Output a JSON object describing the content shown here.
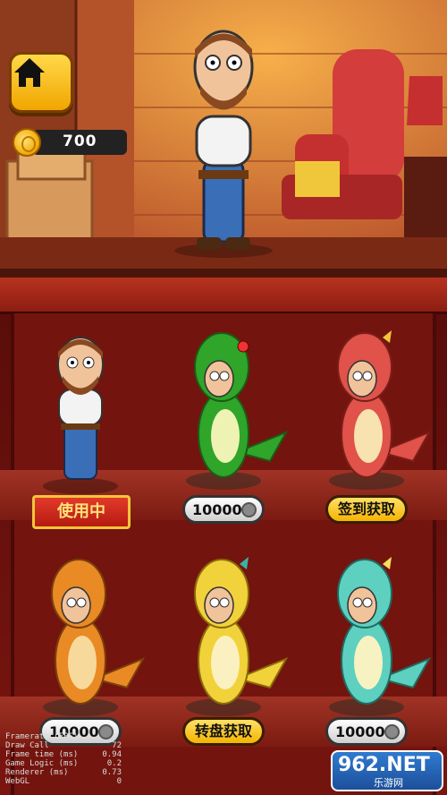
{
  "hud": {
    "coins": "700"
  },
  "shop": {
    "items": [
      {
        "id": "plumber",
        "status_label": "使用中",
        "price": ""
      },
      {
        "id": "dino-green",
        "status_label": "",
        "price": "10000"
      },
      {
        "id": "dino-red",
        "status_label": "签到获取",
        "price": ""
      },
      {
        "id": "dino-orange",
        "status_label": "",
        "price": "10000"
      },
      {
        "id": "dino-yellow",
        "status_label": "转盘获取",
        "price": ""
      },
      {
        "id": "dino-teal",
        "status_label": "",
        "price": "10000"
      }
    ]
  },
  "debug": [
    {
      "label": "Framerate (FPS)",
      "value": ""
    },
    {
      "label": "Draw Call",
      "value": "72"
    },
    {
      "label": "Frame time (ms)",
      "value": "0.94"
    },
    {
      "label": "Game Logic (ms)",
      "value": "0.2"
    },
    {
      "label": "Renderer (ms)",
      "value": "0.73"
    },
    {
      "label": "WebGL",
      "value": "0"
    }
  ],
  "watermark": {
    "logo_text": "962.NET",
    "sub_text": "乐游网"
  },
  "colors": {
    "dino-green": "#2fa52a",
    "dino-red": "#e0524a",
    "dino-orange": "#e98a25",
    "dino-yellow": "#f2d23a",
    "dino-teal": "#5ed0c0",
    "accent": "#f5b400"
  },
  "icons": [
    "home-icon",
    "coin-icon"
  ]
}
